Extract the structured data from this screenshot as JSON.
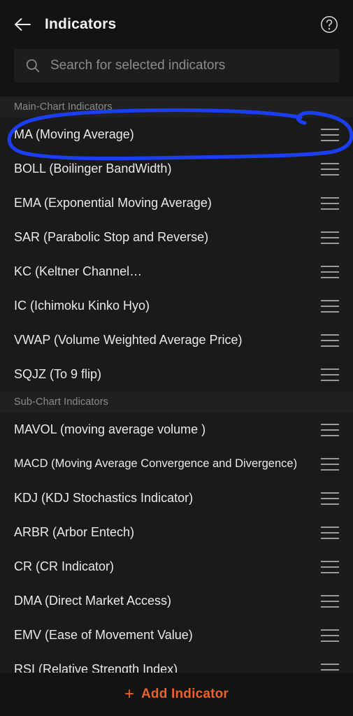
{
  "header": {
    "back_icon": "back-arrow-icon",
    "title": "Indicators",
    "help_icon": "help-circle-icon"
  },
  "search": {
    "icon": "search-icon",
    "value": "",
    "placeholder": "Search for selected indicators"
  },
  "sections": [
    {
      "title": "Main-Chart Indicators",
      "items": [
        {
          "label": "MA (Moving Average)",
          "handle": "drag-handle-icon",
          "annotated": true
        },
        {
          "label": "BOLL (Boilinger BandWidth)",
          "handle": "drag-handle-icon"
        },
        {
          "label": "EMA (Exponential Moving Average)",
          "handle": "drag-handle-icon"
        },
        {
          "label": "SAR (Parabolic Stop and Reverse)",
          "handle": "drag-handle-icon"
        },
        {
          "label": "KC (Keltner Channel…",
          "handle": "drag-handle-icon"
        },
        {
          "label": "IC (Ichimoku Kinko Hyo)",
          "handle": "drag-handle-icon"
        },
        {
          "label": "VWAP (Volume Weighted Average Price)",
          "handle": "drag-handle-icon"
        },
        {
          "label": "SQJZ (To 9 flip)",
          "handle": "drag-handle-icon"
        }
      ]
    },
    {
      "title": "Sub-Chart Indicators",
      "items": [
        {
          "label": "MAVOL (moving average volume )",
          "handle": "drag-handle-icon"
        },
        {
          "label": "MACD (Moving Average Convergence and Divergence)",
          "handle": "drag-handle-icon",
          "small": true
        },
        {
          "label": "KDJ (KDJ Stochastics Indicator)",
          "handle": "drag-handle-icon"
        },
        {
          "label": "ARBR (Arbor Entech)",
          "handle": "drag-handle-icon"
        },
        {
          "label": "CR (CR Indicator)",
          "handle": "drag-handle-icon"
        },
        {
          "label": "DMA (Direct Market Access)",
          "handle": "drag-handle-icon"
        },
        {
          "label": "EMV (Ease of Movement Value)",
          "handle": "drag-handle-icon"
        },
        {
          "label": "RSI (Relative Strength Index)",
          "handle": "drag-handle-icon"
        }
      ]
    }
  ],
  "footer": {
    "plus_icon": "plus-icon",
    "add_label": "Add Indicator"
  },
  "colors": {
    "background": "#131313",
    "row_background": "#1a1a1a",
    "section_header_background": "#202020",
    "accent": "#e8622a",
    "annotation": "#1b3ff0",
    "text_primary": "#e9e9e9",
    "text_muted": "#8b8b8b"
  },
  "annotation": {
    "shape": "hand-drawn-ellipse",
    "target": "MA (Moving Average)",
    "color": "#1b3ff0"
  }
}
